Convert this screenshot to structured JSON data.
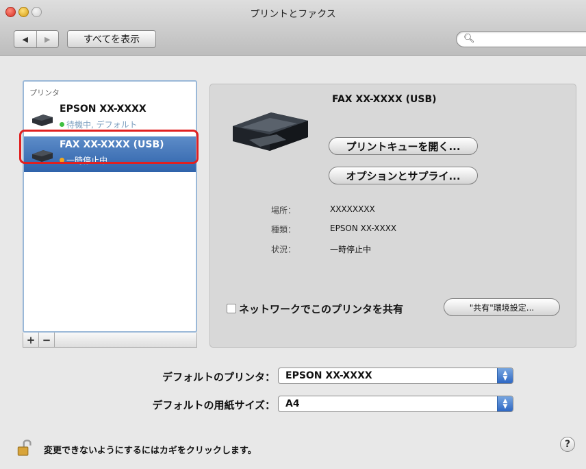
{
  "window": {
    "title": "プリントとファクス",
    "show_all_label": "すべてを表示",
    "back": "◀",
    "forward": "▶",
    "search_icon": "search-icon"
  },
  "printer_list": {
    "section_label": "プリンタ",
    "items": [
      {
        "name": "EPSON XX-XXXX",
        "status": "待機中, デフォルト",
        "status_color": "#3fbf3f",
        "selected": false
      },
      {
        "name": "FAX XX-XXXX (USB)",
        "status": "一時停止中",
        "status_color": "#f2a81d",
        "selected": true
      }
    ],
    "add_label": "+",
    "remove_label": "−"
  },
  "detail": {
    "name": "FAX XX-XXXX (USB)",
    "open_queue_label": "プリントキューを開く...",
    "options_label": "オプションとサプライ...",
    "location_label": "場所：",
    "location_value": "XXXXXXXX",
    "kind_label": "種類：",
    "kind_value": "EPSON XX-XXXX",
    "status_label": "状況：",
    "status_value": "一時停止中",
    "share_label": "ネットワークでこのプリンタを共有",
    "share_checked": false,
    "sharing_prefs_label": "\"共有\"環境設定..."
  },
  "footer": {
    "default_printer_label": "デフォルトのプリンタ：",
    "default_printer_value": "EPSON XX-XXXX",
    "paper_size_label": "デフォルトの用紙サイズ：",
    "paper_size_value": "A4",
    "lock_text": "変更できないようにするにはカギをクリックします。",
    "help": "?"
  },
  "colors": {
    "selection": "#2f63ab",
    "highlight_box": "#e02020"
  }
}
